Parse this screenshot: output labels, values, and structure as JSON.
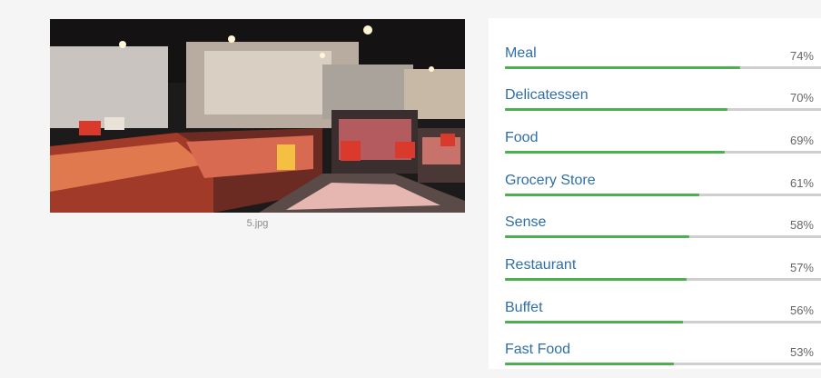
{
  "image": {
    "caption": "5.jpg"
  },
  "labels": [
    {
      "name": "Meal",
      "percent_text": "74%",
      "score": 0.74
    },
    {
      "name": "Delicatessen",
      "percent_text": "70%",
      "score": 0.7
    },
    {
      "name": "Food",
      "percent_text": "69%",
      "score": 0.69
    },
    {
      "name": "Grocery Store",
      "percent_text": "61%",
      "score": 0.61
    },
    {
      "name": "Sense",
      "percent_text": "58%",
      "score": 0.58
    },
    {
      "name": "Restaurant",
      "percent_text": "57%",
      "score": 0.57
    },
    {
      "name": "Buffet",
      "percent_text": "56%",
      "score": 0.56
    },
    {
      "name": "Fast Food",
      "percent_text": "53%",
      "score": 0.53
    }
  ],
  "colors": {
    "label_text": "#2f6fa8",
    "bar_fill": "#4caf50",
    "bar_track": "#cfcfcf"
  }
}
